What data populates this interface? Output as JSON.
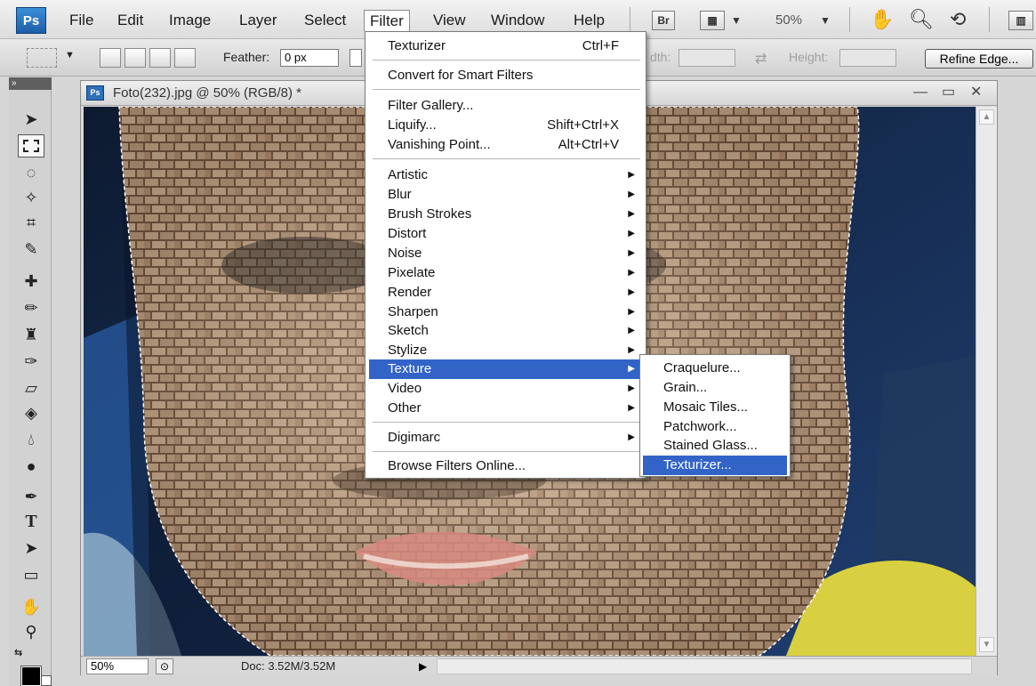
{
  "app": {
    "logo": "Ps"
  },
  "menubar": {
    "items": [
      "File",
      "Edit",
      "Image",
      "Layer",
      "Select",
      "Filter",
      "View",
      "Window",
      "Help"
    ],
    "bridge_label": "Br",
    "zoom": "50%"
  },
  "options": {
    "feather_label": "Feather:",
    "feather_value": "0 px",
    "width_label": "dth:",
    "height_label": "Height:",
    "refine_edge": "Refine Edge..."
  },
  "document": {
    "title": "Foto(232).jpg @ 50% (RGB/8) *",
    "status_zoom": "50%",
    "doc_info": "Doc: 3.52M/3.52M"
  },
  "filter_menu": {
    "last_filter": {
      "label": "Texturizer",
      "shortcut": "Ctrl+F"
    },
    "convert": "Convert for Smart Filters",
    "gallery": "Filter Gallery...",
    "liquify": {
      "label": "Liquify...",
      "shortcut": "Shift+Ctrl+X"
    },
    "vanishing": {
      "label": "Vanishing Point...",
      "shortcut": "Alt+Ctrl+V"
    },
    "categories": [
      "Artistic",
      "Blur",
      "Brush Strokes",
      "Distort",
      "Noise",
      "Pixelate",
      "Render",
      "Sharpen",
      "Sketch",
      "Stylize",
      "Texture",
      "Video",
      "Other"
    ],
    "highlighted_category": "Texture",
    "digimarc": "Digimarc",
    "browse": "Browse Filters Online..."
  },
  "texture_submenu": {
    "items": [
      "Craquelure...",
      "Grain...",
      "Mosaic Tiles...",
      "Patchwork...",
      "Stained Glass...",
      "Texturizer..."
    ],
    "highlighted": "Texturizer..."
  },
  "colors": {
    "menu_highlight": "#3264c8",
    "brick_light": "#c7ad90",
    "brick_dark": "#5a4533",
    "background_blue": "#1c3a6a"
  }
}
